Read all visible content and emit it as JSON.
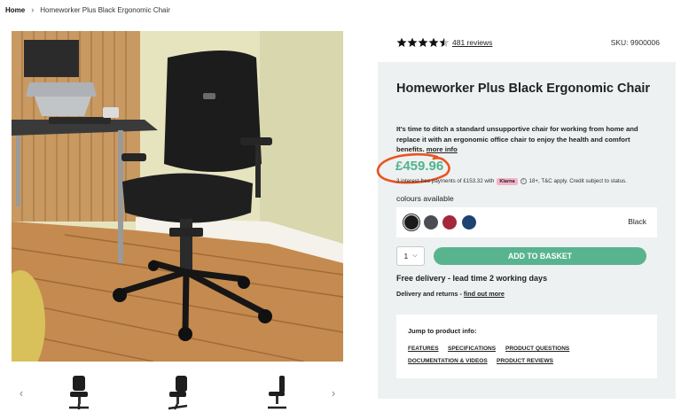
{
  "breadcrumb": {
    "home": "Home",
    "separator": "›",
    "current": "Homeworker Plus Black Ergonomic Chair"
  },
  "rating": {
    "stars": 4.5,
    "max": 5,
    "reviews_text": "481 reviews"
  },
  "sku": "SKU: 9900006",
  "product": {
    "title": "Homeworker Plus Black Ergonomic Chair",
    "description": "It's time to ditch a standard unsupportive chair for working from home and replace it with an ergonomic office chair to enjoy the health and comfort benefits.",
    "more_info": "more info",
    "price": "£459.96",
    "klarna": {
      "text": "3 interest-free payments of £153.32 with",
      "badge": "Klarna",
      "info_icon": "info-icon",
      "terms": "18+, T&C apply. Credit subject to status."
    },
    "colours_label": "colours available",
    "colours": [
      {
        "name": "Black",
        "hex": "#1b1b1b",
        "selected": true
      },
      {
        "name": "Grey",
        "hex": "#4a4d52",
        "selected": false
      },
      {
        "name": "Red",
        "hex": "#a4283a",
        "selected": false
      },
      {
        "name": "Blue",
        "hex": "#1d4372",
        "selected": false
      }
    ],
    "selected_colour": "Black",
    "quantity": "1",
    "add_to_basket": "ADD TO BASKET",
    "delivery": "Free delivery - lead time 2 working days",
    "returns_text": "Delivery and returns -",
    "returns_link": "find out more"
  },
  "jump": {
    "title": "Jump to product info:",
    "links": [
      "FEATURES",
      "SPECIFICATIONS",
      "PRODUCT QUESTIONS",
      "DOCUMENTATION & VIDEOS",
      "PRODUCT REVIEWS"
    ]
  },
  "gallery": {
    "prev_icon": "chevron-left-icon",
    "next_icon": "chevron-right-icon",
    "thumbnail_count": 3
  },
  "colors": {
    "accent": "#58b48f",
    "price": "#4fb58a",
    "panel": "#eef1f2",
    "annotation": "#e8541f"
  }
}
